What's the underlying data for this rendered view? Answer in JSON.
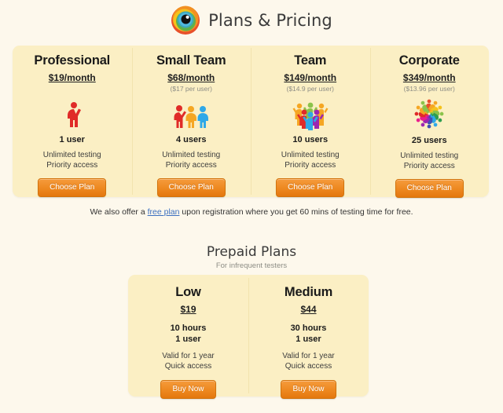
{
  "header": {
    "title": "Plans & Pricing",
    "logo_icon": "eye-logo-icon"
  },
  "plans": {
    "items": [
      {
        "name": "Professional",
        "price": "$19/month",
        "per_user": "",
        "icon": "one-person-icon",
        "users": "1 user",
        "feature_1": "Unlimited testing",
        "feature_2": "Priority access",
        "cta": "Choose Plan"
      },
      {
        "name": "Small Team",
        "price": "$68/month",
        "per_user": "($17 per user)",
        "icon": "three-people-icon",
        "users": "4 users",
        "feature_1": "Unlimited testing",
        "feature_2": "Priority access",
        "cta": "Choose Plan"
      },
      {
        "name": "Team",
        "price": "$149/month",
        "per_user": "($14.9 per user)",
        "icon": "people-group-icon",
        "users": "10 users",
        "feature_1": "Unlimited testing",
        "feature_2": "Priority access",
        "cta": "Choose Plan"
      },
      {
        "name": "Corporate",
        "price": "$349/month",
        "per_user": "($13.96 per user)",
        "icon": "people-circle-icon",
        "users": "25 users",
        "feature_1": "Unlimited testing",
        "feature_2": "Priority access",
        "cta": "Choose Plan"
      }
    ]
  },
  "free_note": {
    "before": "We also offer a ",
    "link": "free plan",
    "after": " upon registration where you get 60 mins of testing time for free."
  },
  "prepaid": {
    "heading": "Prepaid Plans",
    "subheading": "For infrequent testers",
    "items": [
      {
        "name": "Low",
        "price": "$19",
        "hours": "10 hours",
        "users": "1 user",
        "feature_1": "Valid for 1 year",
        "feature_2": "Quick access",
        "cta": "Buy Now"
      },
      {
        "name": "Medium",
        "price": "$44",
        "hours": "30 hours",
        "users": "1 user",
        "feature_1": "Valid for 1 year",
        "feature_2": "Quick access",
        "cta": "Buy Now"
      }
    ]
  },
  "colors": {
    "page_background": "#FDF8EC",
    "panel_background": "#FBEFC4",
    "divider": "#F2E3AE",
    "button_orange": "#EE8A22",
    "link_blue": "#3B6FBF",
    "muted_text": "#8D8D85"
  }
}
